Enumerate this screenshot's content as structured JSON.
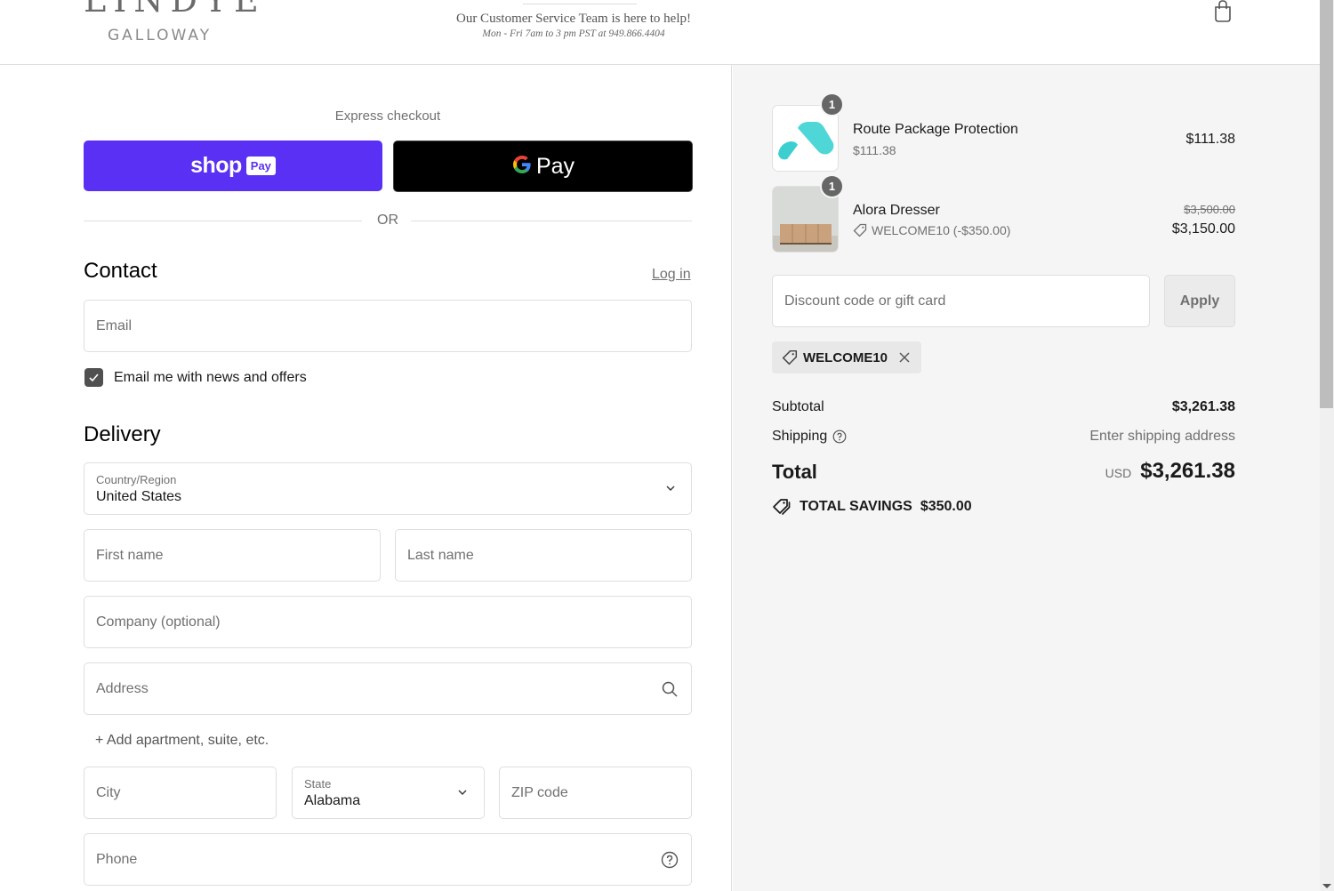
{
  "header": {
    "logo_top": "LINDYE",
    "logo_bottom": "GALLOWAY",
    "service_title": "Our Customer Service Team is here to help!",
    "service_hours": "Mon - Fri 7am to 3 pm PST at 949.866.4404",
    "cart_icon": "shopping-bag-icon"
  },
  "express": {
    "label": "Express checkout",
    "shoppay_word": "shop",
    "shoppay_badge": "Pay",
    "gpay_word": "Pay",
    "or_label": "OR",
    "shoppay_color": "#5a31f4",
    "gpay_color": "#000000"
  },
  "contact": {
    "title": "Contact",
    "login_label": "Log in",
    "email_placeholder": "Email",
    "newsletter_label": "Email me with news and offers",
    "newsletter_checked": true
  },
  "delivery": {
    "title": "Delivery",
    "country_label": "Country/Region",
    "country_value": "United States",
    "first_name_placeholder": "First name",
    "last_name_placeholder": "Last name",
    "company_placeholder": "Company (optional)",
    "address_placeholder": "Address",
    "add_apartment_label": "+ Add apartment, suite, etc.",
    "city_placeholder": "City",
    "state_label": "State",
    "state_value": "Alabama",
    "zip_placeholder": "ZIP code",
    "phone_placeholder": "Phone"
  },
  "summary": {
    "items": [
      {
        "name": "Route Package Protection",
        "subtitle": "$111.38",
        "quantity": "1",
        "price": "$111.38",
        "image": "route-logo"
      },
      {
        "name": "Alora Dresser",
        "discount_code": "WELCOME10 (-$350.00)",
        "quantity": "1",
        "original_price": "$3,500.00",
        "price": "$3,150.00",
        "image": "dresser-photo"
      }
    ],
    "discount_placeholder": "Discount code or gift card",
    "apply_label": "Apply",
    "applied_code": "WELCOME10",
    "subtotal_label": "Subtotal",
    "subtotal_value": "$3,261.38",
    "shipping_label": "Shipping",
    "shipping_value": "Enter shipping address",
    "total_label": "Total",
    "total_currency": "USD",
    "total_value": "$3,261.38",
    "savings_label": "TOTAL SAVINGS",
    "savings_value": "$350.00"
  }
}
